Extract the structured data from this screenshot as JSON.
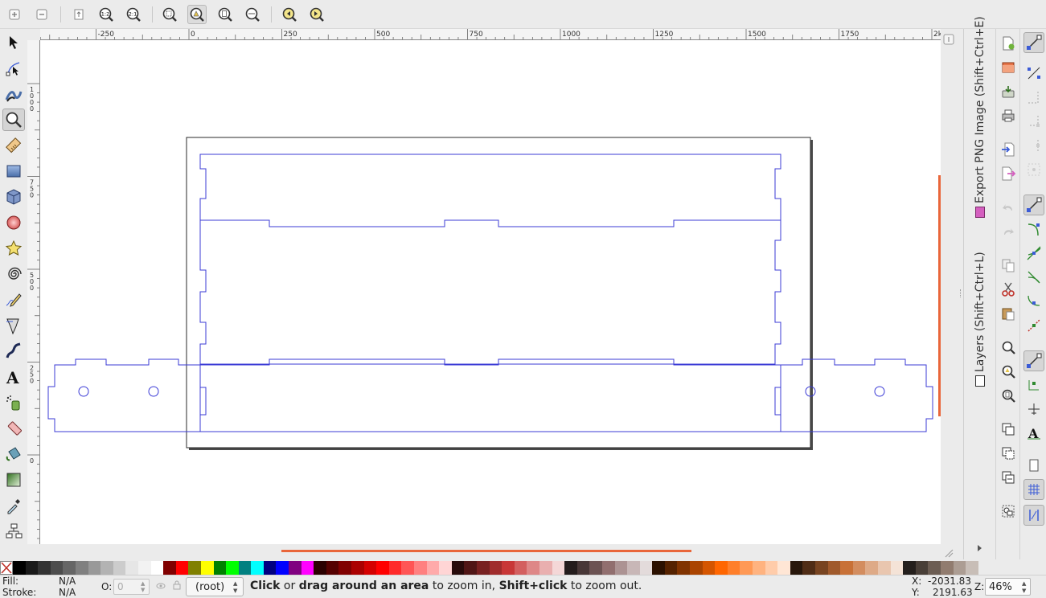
{
  "topbar": {
    "icons": [
      "zoom-in-icon",
      "zoom-out-icon",
      "zoom-page-icon",
      "zoom-1-1-icon",
      "zoom-1-2-icon",
      "zoom-2-1-icon",
      "zoom-selection-icon",
      "zoom-drawing-icon",
      "zoom-page-fit-icon",
      "zoom-page-width-icon",
      "zoom-previous-icon",
      "zoom-next-icon"
    ],
    "zoom_1_2": "1:2",
    "zoom_2_1": "2:1"
  },
  "tools": [
    "selector-tool",
    "node-tool",
    "tweak-tool",
    "zoom-tool",
    "measure-tool",
    "rectangle-tool",
    "3d-box-tool",
    "ellipse-tool",
    "star-tool",
    "spiral-tool",
    "pencil-tool",
    "pen-tool",
    "calligraphy-tool",
    "text-tool",
    "spray-tool",
    "eraser-tool",
    "paint-bucket-tool",
    "gradient-tool",
    "dropper-tool",
    "connector-tool"
  ],
  "hruler": {
    "labels": [
      "-250",
      "0",
      "250",
      "500",
      "750",
      "1000",
      "1250",
      "1500",
      "1750",
      "2k"
    ]
  },
  "vruler": {
    "labels": [
      "1000",
      "750",
      "500",
      "250",
      "0"
    ]
  },
  "dock": {
    "tab_export": "Export PNG Image (Shift+Ctrl+E)",
    "tab_layers": "Layers (Shift+Ctrl+L)"
  },
  "commands": [
    "new-document-icon",
    "open-icon",
    "save-icon",
    "print-icon",
    "import-icon",
    "export-icon",
    "undo-icon",
    "redo-icon",
    "copy-icon",
    "cut-icon",
    "paste-icon",
    "zoom-selection-icon",
    "zoom-drawing-icon",
    "zoom-page-icon",
    "duplicate-icon",
    "clone-icon",
    "unlink-clone-icon",
    "group-icon"
  ],
  "snap": [
    "snap-enable-icon",
    "snap-bbox-icon",
    "snap-bbox-edge-icon",
    "snap-bbox-corner-icon",
    "snap-bbox-midpoint-icon",
    "snap-bbox-center-icon",
    "snap-nodes-icon",
    "snap-path-icon",
    "snap-path-intersection-icon",
    "snap-cusp-icon",
    "snap-smooth-icon",
    "snap-line-midpoint-icon",
    "snap-others-icon",
    "snap-object-center-icon",
    "snap-rotation-center-icon",
    "snap-text-baseline-icon",
    "snap-page-border-icon",
    "snap-grid-icon",
    "snap-guide-icon"
  ],
  "palette": [
    "#000000",
    "#1a1a1a",
    "#333333",
    "#4d4d4d",
    "#666666",
    "#808080",
    "#999999",
    "#b3b3b3",
    "#cccccc",
    "#e6e6e6",
    "#f2f2f2",
    "#ffffff",
    "#800000",
    "#ff0000",
    "#808000",
    "#ffff00",
    "#008000",
    "#00ff00",
    "#008080",
    "#00ffff",
    "#000080",
    "#0000ff",
    "#800080",
    "#ff00ff",
    "#2b0000",
    "#550000",
    "#800000",
    "#aa0000",
    "#d40000",
    "#ff0000",
    "#ff2a2a",
    "#ff5555",
    "#ff8080",
    "#ffaaaa",
    "#ffd5d5",
    "#280b0b",
    "#501616",
    "#782121",
    "#a02c2c",
    "#c83737",
    "#d35f5f",
    "#de8787",
    "#e9afaf",
    "#f4d7d7",
    "#241c1c",
    "#483737",
    "#6c5353",
    "#916f6f",
    "#ac9393",
    "#c8b7b7",
    "#e3dbdb",
    "#2b1100",
    "#552200",
    "#803300",
    "#aa4400",
    "#d45500",
    "#ff6600",
    "#ff7f2a",
    "#ff9955",
    "#ffb380",
    "#ffccaa",
    "#ffe6d5",
    "#28170b",
    "#502d16",
    "#784421",
    "#a05a2c",
    "#c87137",
    "#d38d5f",
    "#deaa87",
    "#e9c6af",
    "#f4e3d7",
    "#241f1c",
    "#483e37",
    "#6c5d53",
    "#917c6f",
    "#ac9d93",
    "#c8beb7"
  ],
  "status": {
    "fill_label": "Fill:",
    "fill_value": "N/A",
    "stroke_label": "Stroke:",
    "stroke_value": "N/A",
    "opacity_label": "O:",
    "opacity_value": "0",
    "layer_value": "(root)",
    "msg_click": "Click",
    "msg_or": " or ",
    "msg_drag": "drag around an area",
    "msg_zoomin": " to zoom in, ",
    "msg_shift": "Shift+click",
    "msg_zoomout": " to zoom out.",
    "x_label": "X:",
    "x_value": "-2031.83",
    "y_label": "Y:",
    "y_value": "2191.63",
    "z_label": "Z:",
    "zoom_value": "46%"
  },
  "colors": {
    "path_stroke": "#3b3bd6",
    "accent": "#e9663a"
  }
}
